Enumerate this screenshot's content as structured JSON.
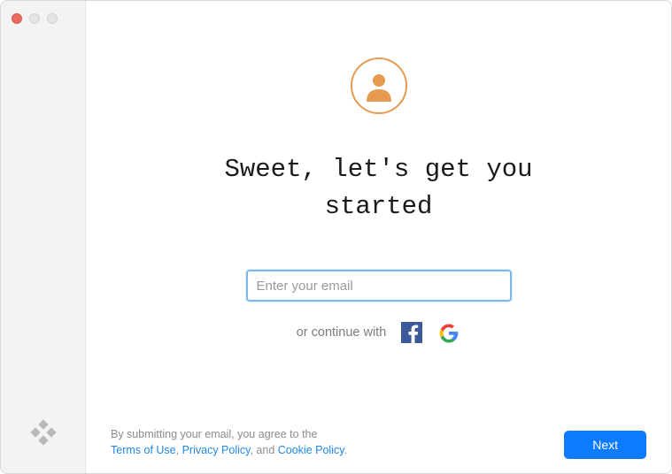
{
  "heading": "Sweet, let's get you started",
  "email": {
    "value": "",
    "placeholder": "Enter your email"
  },
  "continue_text": "or continue with",
  "social": {
    "facebook": "facebook",
    "google": "google"
  },
  "legal": {
    "prefix": "By submitting your email, you agree to the",
    "terms": "Terms of Use",
    "sep1": ", ",
    "privacy": "Privacy Policy",
    "sep2": ", and ",
    "cookie": "Cookie Policy",
    "suffix": "."
  },
  "next_label": "Next"
}
